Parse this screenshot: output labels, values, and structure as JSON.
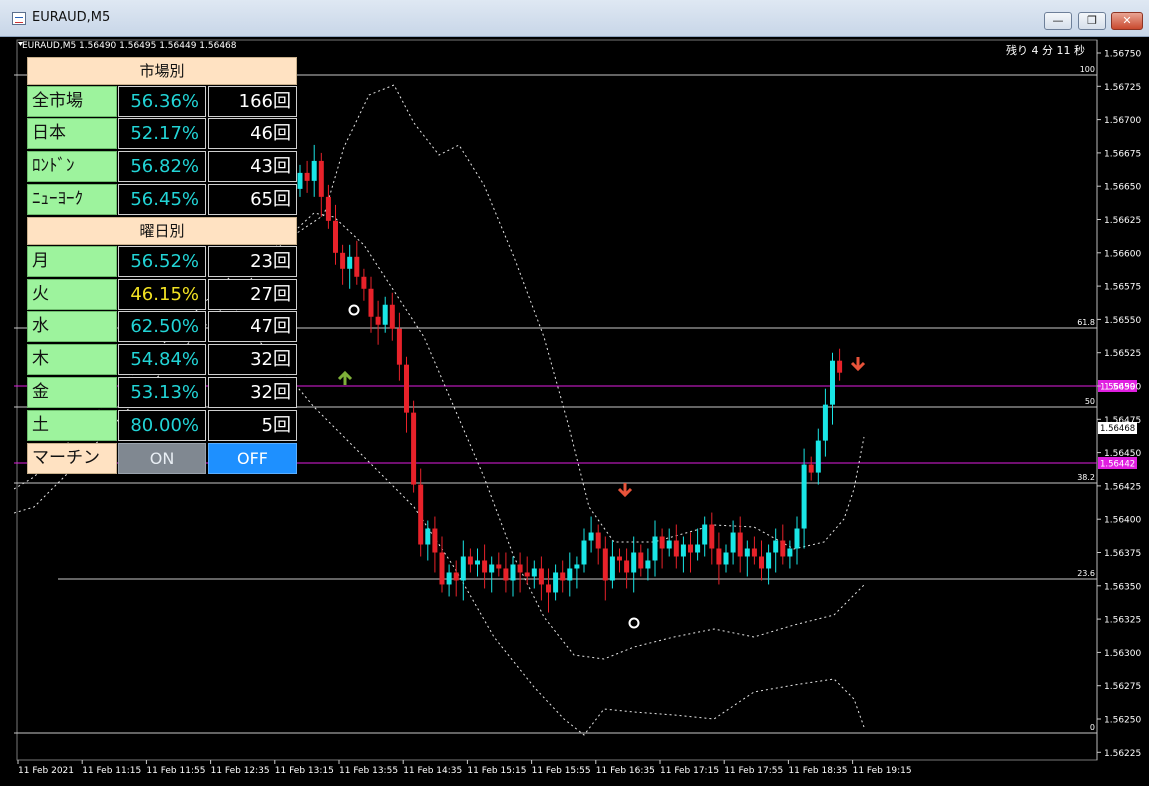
{
  "window": {
    "title": "EURAUD,M5",
    "minimize_label": "—",
    "restore_label": "❐",
    "close_label": "✕"
  },
  "chart": {
    "header": "EURAUD,M5  1.56490 1.56495 1.56449 1.56468",
    "countdown": "残り 4 分 11 秒",
    "price_ticks": [
      "1.56750",
      "1.56725",
      "1.56700",
      "1.56675",
      "1.56650",
      "1.56625",
      "1.56600",
      "1.56575",
      "1.56550",
      "1.56525",
      "1.56500",
      "1.56475",
      "1.56450",
      "1.56425",
      "1.56400",
      "1.56375",
      "1.56350",
      "1.56325",
      "1.56300",
      "1.56275",
      "1.56250",
      "1.56225"
    ],
    "time_ticks": [
      "11 Feb 2021",
      "11 Feb 11:15",
      "11 Feb 11:55",
      "11 Feb 12:35",
      "11 Feb 13:15",
      "11 Feb 13:55",
      "11 Feb 14:35",
      "11 Feb 15:15",
      "11 Feb 15:55",
      "11 Feb 16:35",
      "11 Feb 17:15",
      "11 Feb 17:55",
      "11 Feb 18:35",
      "11 Feb 19:15"
    ],
    "fib_levels": [
      "100",
      "61.8",
      "50",
      "38.2",
      "23.6",
      "0"
    ],
    "price_labels": {
      "upper_magenta": "1.56499",
      "current": "1.56468",
      "lower_magenta": "1.56442"
    },
    "colors": {
      "bull": "#19e6e6",
      "bear": "#e8222a",
      "magenta": "#e01ee0",
      "arrow_down": "#e8533a",
      "arrow_up": "#7fb03a"
    }
  },
  "panel": {
    "market_header": "市場別",
    "markets": [
      {
        "label": "全市場",
        "pct": "56.36%",
        "count": "166回"
      },
      {
        "label": "日本",
        "pct": "52.17%",
        "count": "46回"
      },
      {
        "label": "ﾛﾝﾄﾞﾝ",
        "pct": "56.82%",
        "count": "43回"
      },
      {
        "label": "ﾆｭｰﾖｰｸ",
        "pct": "56.45%",
        "count": "65回"
      }
    ],
    "weekday_header": "曜日別",
    "weekdays": [
      {
        "label": "月",
        "pct": "56.52%",
        "count": "23回"
      },
      {
        "label": "火",
        "pct": "46.15%",
        "count": "27回"
      },
      {
        "label": "水",
        "pct": "62.50%",
        "count": "47回"
      },
      {
        "label": "木",
        "pct": "54.84%",
        "count": "32回"
      },
      {
        "label": "金",
        "pct": "53.13%",
        "count": "32回"
      },
      {
        "label": "土",
        "pct": "80.00%",
        "count": "5回"
      }
    ],
    "martin_label": "マーチン",
    "on_label": "ON",
    "off_label": "OFF"
  }
}
